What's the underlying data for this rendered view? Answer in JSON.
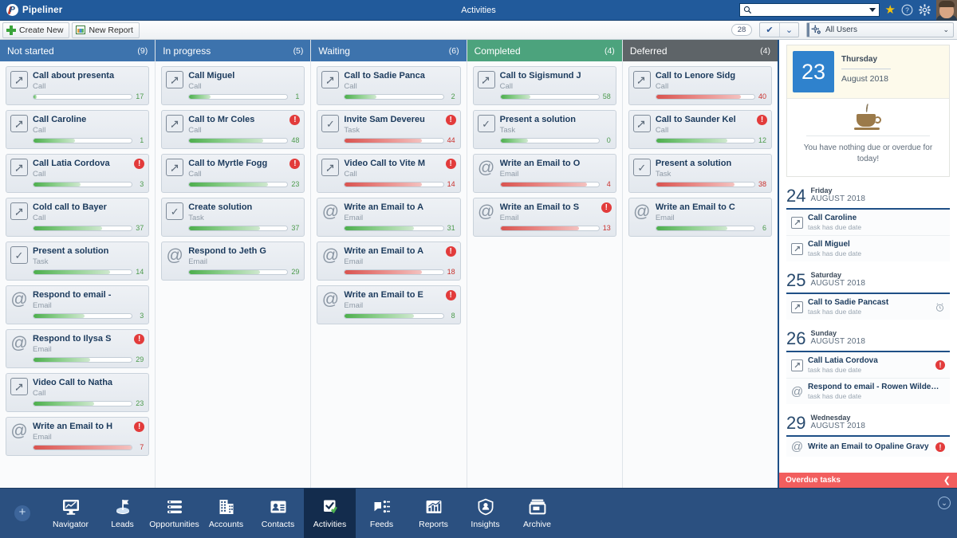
{
  "header": {
    "brand": "Pipeliner",
    "brand_mark": "P",
    "title": "Activities",
    "search_placeholder": "",
    "search_value": "",
    "icons": {
      "search": "search-icon",
      "star": "★",
      "help": "?",
      "gear": "gear-icon"
    }
  },
  "toolbar": {
    "create_new": "Create New",
    "new_report": "New Report",
    "count": "28",
    "check_label": "✔",
    "check_caret": "⌄",
    "user_filter": "All Users",
    "user_filter_caret": "⌄"
  },
  "kanban": {
    "columns": [
      {
        "name": "Not started",
        "count": "(9)",
        "color": "#3d73ad",
        "cards": [
          {
            "title": "Call about presenta",
            "type": "Call",
            "icon": "call-icon",
            "progress": 3,
            "num": "17",
            "state": "green",
            "alert": false
          },
          {
            "title": "Call Caroline",
            "type": "Call",
            "icon": "call-icon",
            "progress": 42,
            "num": "1",
            "state": "green",
            "alert": false
          },
          {
            "title": "Call Latia Cordova",
            "type": "Call",
            "icon": "call-icon",
            "progress": 48,
            "num": "3",
            "state": "green",
            "alert": true
          },
          {
            "title": "Cold call to Bayer",
            "type": "Call",
            "icon": "call-icon",
            "progress": 70,
            "num": "37",
            "state": "green",
            "alert": false
          },
          {
            "title": "Present a solution",
            "type": "Task",
            "icon": "task-icon",
            "progress": 78,
            "num": "14",
            "state": "green",
            "alert": false
          },
          {
            "title": "Respond to email -",
            "type": "Email",
            "icon": "email-icon",
            "progress": 52,
            "num": "3",
            "state": "green",
            "alert": false
          },
          {
            "title": "Respond to Ilysa S",
            "type": "Email",
            "icon": "email-icon",
            "progress": 58,
            "num": "29",
            "state": "green",
            "alert": true
          },
          {
            "title": "Video Call to Natha",
            "type": "Call",
            "icon": "call-icon",
            "progress": 62,
            "num": "23",
            "state": "green",
            "alert": false
          },
          {
            "title": "Write an Email to H",
            "type": "Email",
            "icon": "email-icon",
            "progress": 100,
            "num": "7",
            "state": "red",
            "alert": true
          }
        ]
      },
      {
        "name": "In progress",
        "count": "(5)",
        "color": "#3d73ad",
        "cards": [
          {
            "title": "Call Miguel",
            "type": "Call",
            "icon": "call-icon",
            "progress": 22,
            "num": "1",
            "state": "green",
            "alert": false
          },
          {
            "title": "Call to Mr Coles",
            "type": "Call",
            "icon": "call-icon",
            "progress": 75,
            "num": "48",
            "state": "green",
            "alert": true
          },
          {
            "title": "Call to Myrtle Fogg",
            "type": "Call",
            "icon": "call-icon",
            "progress": 80,
            "num": "23",
            "state": "green",
            "alert": true
          },
          {
            "title": "Create solution",
            "type": "Task",
            "icon": "task-icon",
            "progress": 72,
            "num": "37",
            "state": "green",
            "alert": false
          },
          {
            "title": "Respond to Jeth G",
            "type": "Email",
            "icon": "email-icon",
            "progress": 72,
            "num": "29",
            "state": "green",
            "alert": false
          }
        ]
      },
      {
        "name": "Waiting",
        "count": "(6)",
        "color": "#3d73ad",
        "cards": [
          {
            "title": "Call to Sadie Panca",
            "type": "Call",
            "icon": "call-icon",
            "progress": 32,
            "num": "2",
            "state": "green",
            "alert": false
          },
          {
            "title": "Invite Sam Devereu",
            "type": "Task",
            "icon": "task-icon",
            "progress": 78,
            "num": "44",
            "state": "red",
            "alert": true
          },
          {
            "title": "Video Call to Vite M",
            "type": "Call",
            "icon": "call-icon",
            "progress": 78,
            "num": "14",
            "state": "red",
            "alert": true
          },
          {
            "title": "Write an Email to A",
            "type": "Email",
            "icon": "email-icon",
            "progress": 70,
            "num": "31",
            "state": "green",
            "alert": false
          },
          {
            "title": "Write an Email to A",
            "type": "Email",
            "icon": "email-icon",
            "progress": 78,
            "num": "18",
            "state": "red",
            "alert": true
          },
          {
            "title": "Write an Email to E",
            "type": "Email",
            "icon": "email-icon",
            "progress": 70,
            "num": "8",
            "state": "green",
            "alert": true
          }
        ]
      },
      {
        "name": "Completed",
        "count": "(4)",
        "color": "#4ca37d",
        "cards": [
          {
            "title": "Call to Sigismund J",
            "type": "Call",
            "icon": "call-icon",
            "progress": 30,
            "num": "58",
            "state": "green",
            "alert": false
          },
          {
            "title": "Present a solution",
            "type": "Task",
            "icon": "task-icon",
            "progress": 28,
            "num": "0",
            "state": "green",
            "alert": false
          },
          {
            "title": "Write an Email to O",
            "type": "Email",
            "icon": "email-icon",
            "progress": 88,
            "num": "4",
            "state": "red",
            "alert": false
          },
          {
            "title": "Write an Email to S",
            "type": "Email",
            "icon": "email-icon",
            "progress": 80,
            "num": "13",
            "state": "red",
            "alert": true
          }
        ]
      },
      {
        "name": "Deferred",
        "count": "(4)",
        "color": "#5e6468",
        "cards": [
          {
            "title": "Call to Lenore Sidg",
            "type": "Call",
            "icon": "call-icon",
            "progress": 86,
            "num": "40",
            "state": "red",
            "alert": false
          },
          {
            "title": "Call to Saunder Kel",
            "type": "Call",
            "icon": "call-icon",
            "progress": 72,
            "num": "12",
            "state": "green",
            "alert": true
          },
          {
            "title": "Present a solution",
            "type": "Task",
            "icon": "task-icon",
            "progress": 80,
            "num": "38",
            "state": "red",
            "alert": false
          },
          {
            "title": "Write an Email to C",
            "type": "Email",
            "icon": "email-icon",
            "progress": 72,
            "num": "6",
            "state": "green",
            "alert": false
          }
        ]
      }
    ]
  },
  "sidebar": {
    "today": {
      "day_number": "23",
      "day_of_week": "Thursday",
      "month_year": "August 2018",
      "empty_message": "You have nothing due or overdue for today!",
      "icon": "coffee-cup-icon"
    },
    "days": [
      {
        "number": "24",
        "dow": "Friday",
        "month": "AUGUST 2018",
        "items": [
          {
            "title": "Call Caroline",
            "sub": "task has due date",
            "icon": "call-icon",
            "alarm": false,
            "alert": false
          },
          {
            "title": "Call Miguel",
            "sub": "task has due date",
            "icon": "call-icon",
            "alarm": false,
            "alert": false
          }
        ]
      },
      {
        "number": "25",
        "dow": "Saturday",
        "month": "AUGUST 2018",
        "items": [
          {
            "title": "Call to Sadie Pancast",
            "sub": "task has due date",
            "icon": "call-icon",
            "alarm": true,
            "alert": false
          }
        ]
      },
      {
        "number": "26",
        "dow": "Sunday",
        "month": "AUGUST 2018",
        "items": [
          {
            "title": "Call Latia Cordova",
            "sub": "task has due date",
            "icon": "call-icon",
            "alarm": false,
            "alert": true
          },
          {
            "title": "Respond to email - Rowen Wilders...",
            "sub": "task has due date",
            "icon": "email-icon",
            "alarm": false,
            "alert": false
          }
        ]
      },
      {
        "number": "29",
        "dow": "Wednesday",
        "month": "AUGUST 2018",
        "items": [
          {
            "title": "Write an Email to Opaline Gravy",
            "sub": "",
            "icon": "email-icon",
            "alarm": false,
            "alert": true
          }
        ]
      }
    ],
    "overdue": {
      "label": "Overdue tasks",
      "chevron": "❮"
    }
  },
  "bottomnav": {
    "add_label": "+",
    "collapse_label": "⌄",
    "items": [
      {
        "label": "Navigator",
        "icon": "navigator-icon",
        "active": false
      },
      {
        "label": "Leads",
        "icon": "leads-icon",
        "active": false
      },
      {
        "label": "Opportunities",
        "icon": "opportunities-icon",
        "active": false
      },
      {
        "label": "Accounts",
        "icon": "accounts-icon",
        "active": false
      },
      {
        "label": "Contacts",
        "icon": "contacts-icon",
        "active": false
      },
      {
        "label": "Activities",
        "icon": "activities-icon",
        "active": true
      },
      {
        "label": "Feeds",
        "icon": "feeds-icon",
        "active": false
      },
      {
        "label": "Reports",
        "icon": "reports-icon",
        "active": false
      },
      {
        "label": "Insights",
        "icon": "insights-icon",
        "active": false
      },
      {
        "label": "Archive",
        "icon": "archive-icon",
        "active": false
      }
    ]
  },
  "colors": {
    "header_blue": "#215a9b",
    "column_blue": "#3d73ad",
    "column_green": "#4ca37d",
    "column_gray": "#5e6468",
    "overdue_red": "#f25e5e",
    "nav_blue": "#2b5080",
    "nav_active": "#132c4d"
  }
}
